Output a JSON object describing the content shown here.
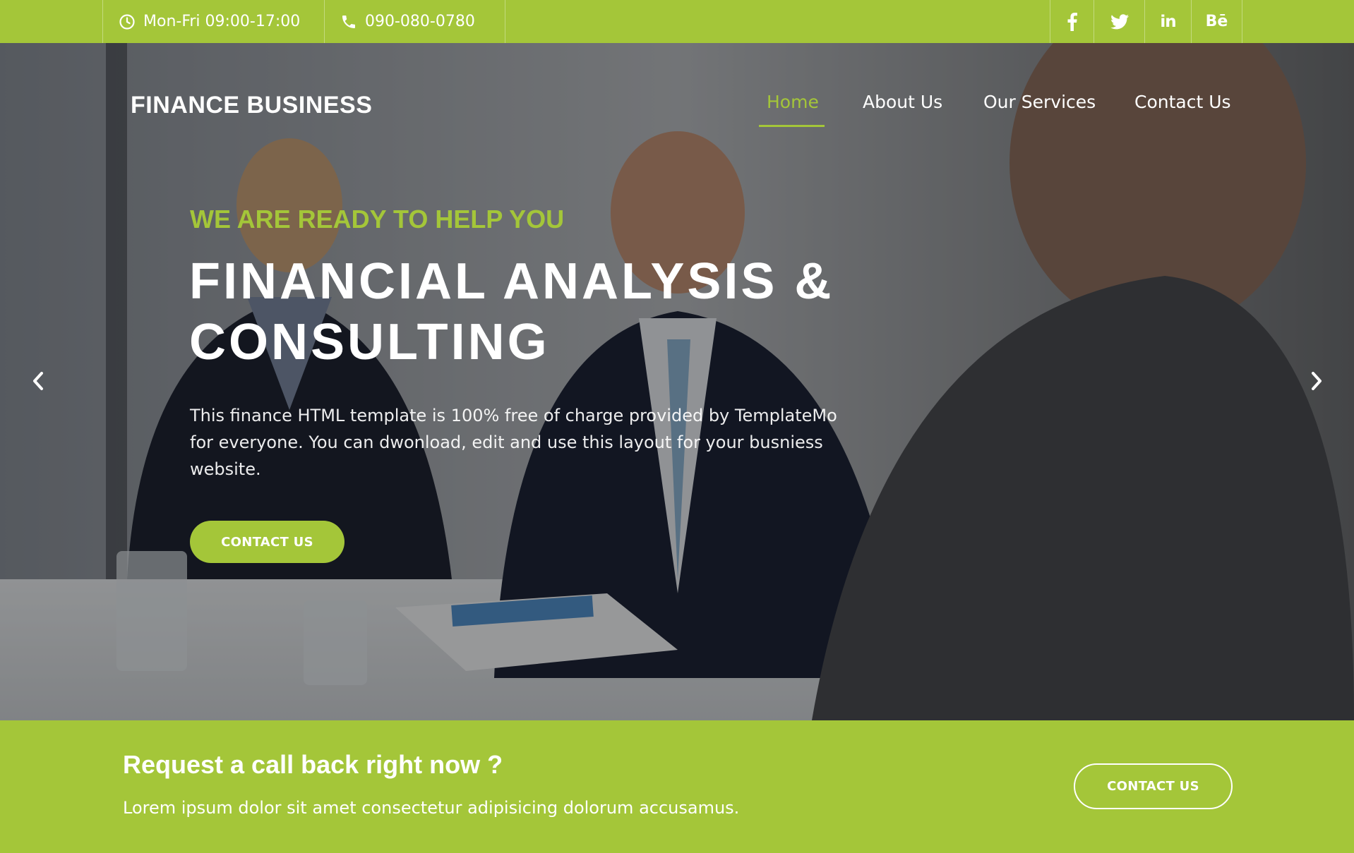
{
  "topbar": {
    "hours": "Mon-Fri 09:00-17:00",
    "phone": "090-080-0780",
    "hours_icon": "clock-icon",
    "phone_icon": "phone-icon",
    "social": [
      "facebook-icon",
      "twitter-icon",
      "linkedin-icon",
      "behance-icon"
    ],
    "linkedin_glyph": "in",
    "behance_glyph": "Bē"
  },
  "header": {
    "brand": "FINANCE BUSINESS",
    "nav": [
      {
        "label": "Home",
        "active": true
      },
      {
        "label": "About Us",
        "active": false
      },
      {
        "label": "Our Services",
        "active": false
      },
      {
        "label": "Contact Us",
        "active": false
      }
    ]
  },
  "hero": {
    "tagline": "WE ARE READY TO HELP YOU",
    "headline_line1": "FINANCIAL ANALYSIS &",
    "headline_line2": "CONSULTING",
    "description": "This finance HTML template is 100% free of charge provided by TemplateMo for everyone. You can dwonload, edit and use this layout for your busniess website.",
    "button": "CONTACT US",
    "prev_icon": "chevron-left-icon",
    "next_icon": "chevron-right-icon"
  },
  "callback": {
    "title": "Request a call back right now ?",
    "text": "Lorem ipsum dolor sit amet consectetur adipisicing dolorum accusamus.",
    "button": "CONTACT US"
  },
  "colors": {
    "accent": "#a4c639",
    "text_light": "#ffffff",
    "overlay": "#000000"
  }
}
